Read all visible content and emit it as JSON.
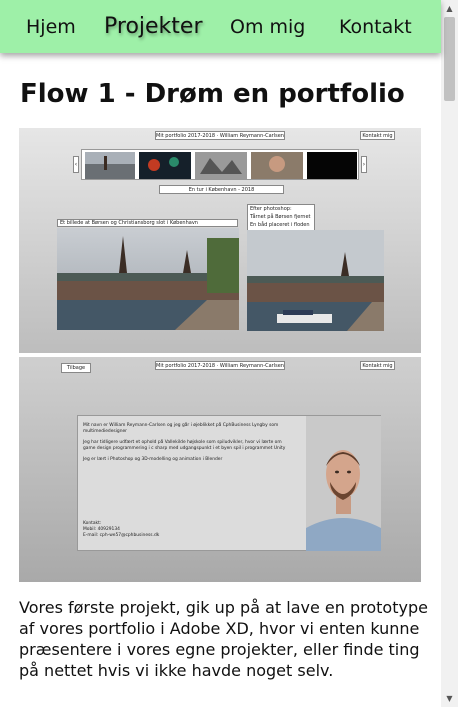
{
  "nav": {
    "items": [
      {
        "label": "Hjem",
        "active": false
      },
      {
        "label": "Projekter",
        "active": true
      },
      {
        "label": "Om mig",
        "active": false
      },
      {
        "label": "Kontakt",
        "active": false
      }
    ],
    "background": "#9ef0a8"
  },
  "page": {
    "title": "Flow 1 - Drøm en portfolio",
    "description": "Vores første projekt, gik up på at lave en prototype af vores portfolio i Adobe XD, hvor vi enten kunne præsentere i vores egne projekter, eller finde ting på nettet hvis vi ikke havde noget selv."
  },
  "mockup1": {
    "header": "Mit portfolio 2017-2018 · William Reymann-Carlsen",
    "contact_button": "Kontakt mig",
    "carousel_caption": "En tur i København - 2018",
    "photo_left_caption": "Et billede at Børsen og Christiansborg slot i København",
    "photo_right_caption_lines": [
      "Efter photoshop:",
      "Tårnet på Børsen fjernet",
      "En båd placeret i floden"
    ]
  },
  "mockup2": {
    "back_button": "Tilbage",
    "header": "Mit portfolio 2017-2018 · William Reymann-Carlsen",
    "contact_button": "Kontakt mig",
    "bio_lines": [
      "Mit navn er William Reymann-Carlsen og jeg går i øjeblikket på CphBusiness Lyngby som",
      "multimediedesigner",
      "",
      "Jeg har tidligere udfært et ophold på Vallekilde højskole som spiludvikler, hvor vi lærte om",
      "game design programmering i c sharp med udgangspunkt i et byen spil i programmet Unity",
      "",
      "Jeg er lært i Photoshop og 3D-modelling og animation i Blender"
    ],
    "contact_lines": [
      "Kontakt:",
      "Mobil: 40929134",
      "E-mail: cph-we57@cphbusiness.dk"
    ]
  },
  "scrollbar": {
    "up_icon": "triangle-up",
    "down_icon": "triangle-down"
  }
}
